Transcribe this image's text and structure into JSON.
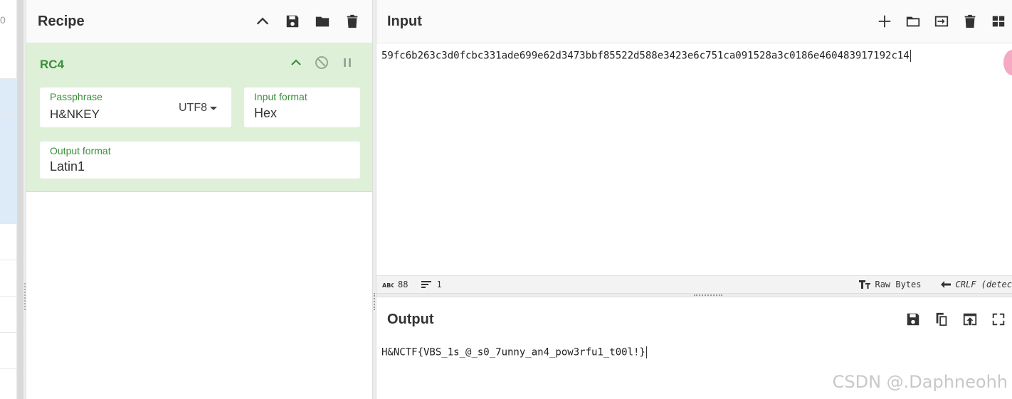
{
  "left_strip": {
    "digit": "0"
  },
  "recipe": {
    "title": "Recipe",
    "operation": {
      "name": "RC4",
      "passphrase": {
        "label": "Passphrase",
        "value": "H&NKEY",
        "encoding": "UTF8"
      },
      "input_format": {
        "label": "Input format",
        "value": "Hex"
      },
      "output_format": {
        "label": "Output format",
        "value": "Latin1"
      }
    }
  },
  "input": {
    "title": "Input",
    "text": "59fc6b263c3d0fcbc331ade699e62d3473bbf85522d588e3423e6c751ca091528a3c0186e460483917192c14",
    "status": {
      "length": "88",
      "lines": "1",
      "encoding": "Raw Bytes",
      "eol": "CRLF (detec"
    }
  },
  "output": {
    "title": "Output",
    "text": "H&NCTF{VBS_1s_@_s0_7unny_an4_pow3rfu1_t00l!}"
  },
  "watermark": "CSDN @.Daphneohh",
  "colors": {
    "op_background": "#dff0d8",
    "op_accent": "#3c8f3c",
    "selected_row": "#dcebf7"
  }
}
